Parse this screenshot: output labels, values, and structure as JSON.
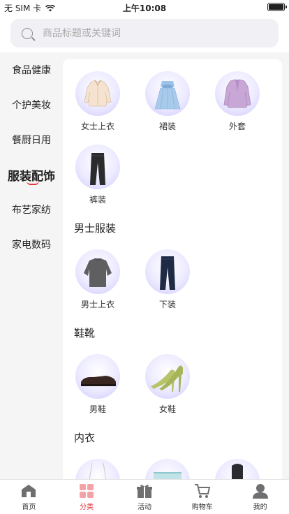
{
  "status_bar": {
    "carrier": "无 SIM 卡",
    "time": "上午10:08"
  },
  "search": {
    "placeholder": "商品标题或关键词"
  },
  "sidebar": {
    "items": [
      {
        "label": "食品健康",
        "active": false
      },
      {
        "label": "个护美妆",
        "active": false
      },
      {
        "label": "餐厨日用",
        "active": false
      },
      {
        "label": "服装配饰",
        "active": true
      },
      {
        "label": "布艺家纺",
        "active": false
      },
      {
        "label": "家电数码",
        "active": false
      }
    ]
  },
  "content": {
    "top_items": [
      "女士上衣",
      "裙装",
      "外套",
      "裤装"
    ],
    "sections": [
      {
        "title": "男士服装",
        "items": [
          "男士上衣",
          "下装"
        ]
      },
      {
        "title": "鞋靴",
        "items": [
          "男鞋",
          "女鞋"
        ]
      },
      {
        "title": "内衣",
        "items": []
      }
    ]
  },
  "tabbar": {
    "items": [
      {
        "label": "首页",
        "icon": "home-icon"
      },
      {
        "label": "分类",
        "icon": "category-icon"
      },
      {
        "label": "活动",
        "icon": "gift-icon"
      },
      {
        "label": "购物车",
        "icon": "cart-icon"
      },
      {
        "label": "我的",
        "icon": "profile-icon"
      }
    ],
    "active_color": "#e8323c"
  },
  "colors": {
    "accent": "#e8323c",
    "circle_tint": "#cdc8ff"
  }
}
